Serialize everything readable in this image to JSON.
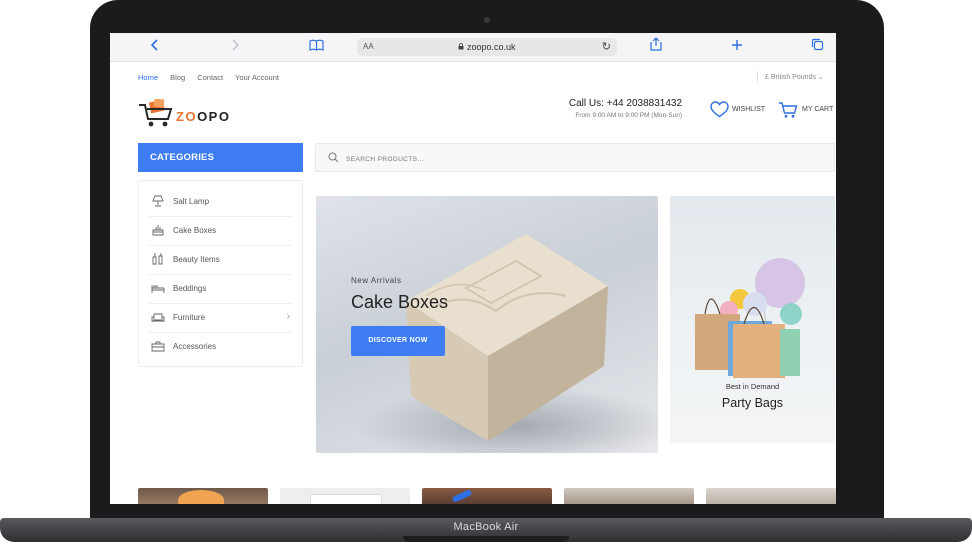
{
  "device": {
    "label": "MacBook Air"
  },
  "browser": {
    "address": {
      "aa": "AA",
      "url": "zoopo.co.uk"
    }
  },
  "topbar": {
    "links": [
      "Home",
      "Blog",
      "Contact",
      "Your Account"
    ],
    "currency": "£ British Pounds"
  },
  "header": {
    "logo": "ZOOPO",
    "call_line": "Call Us: +44 2038831432",
    "hours": "From 9:00 AM to 9:00 PM (Mon-Sun)",
    "wishlist": "WISHLIST",
    "cart": "MY CART"
  },
  "categories": {
    "title": "CATEGORIES",
    "items": [
      {
        "label": "Salt Lamp",
        "icon": "lamp-icon"
      },
      {
        "label": "Cake Boxes",
        "icon": "cake-icon"
      },
      {
        "label": "Beauty Items",
        "icon": "beauty-icon"
      },
      {
        "label": "Beddings",
        "icon": "bed-icon"
      },
      {
        "label": "Furniture",
        "icon": "sofa-icon"
      },
      {
        "label": "Accessories",
        "icon": "bag-icon"
      }
    ]
  },
  "search": {
    "placeholder": "SEARCH PRODUCTS..."
  },
  "hero": {
    "subtitle": "New Arrivals",
    "title": "Cake Boxes",
    "button": "DISCOVER NOW"
  },
  "side_banner": {
    "subtitle": "Best in Demand",
    "title": "Party Bags"
  },
  "colors": {
    "accent": "#3d7cf3",
    "brand": "#e8742e",
    "frame": "#1b1b1d"
  }
}
